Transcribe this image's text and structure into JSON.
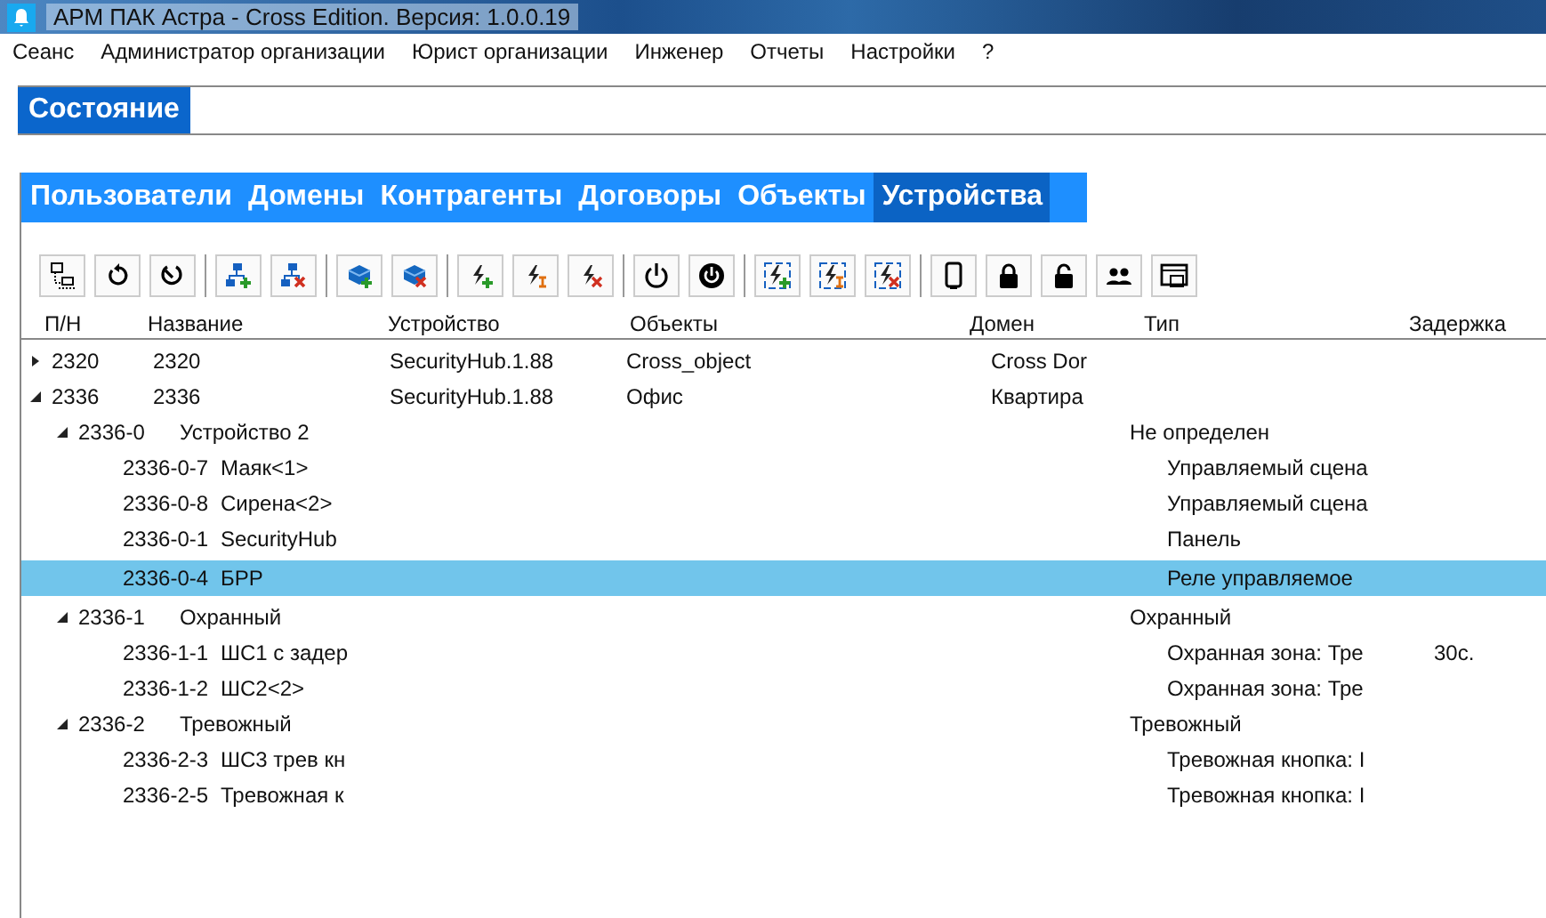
{
  "window": {
    "title": "АРМ ПАК Астра - Cross Edition. Версия: 1.0.0.19"
  },
  "menu": [
    "Сеанс",
    "Администратор организации",
    "Юрист организации",
    "Инженер",
    "Отчеты",
    "Настройки",
    "?"
  ],
  "state_tab": {
    "label": "Состояние"
  },
  "tabs": [
    {
      "label": "Пользователи",
      "selected": false
    },
    {
      "label": "Домены",
      "selected": false
    },
    {
      "label": "Контрагенты",
      "selected": false
    },
    {
      "label": "Договоры",
      "selected": false
    },
    {
      "label": "Объекты",
      "selected": false
    },
    {
      "label": "Устройства",
      "selected": true
    }
  ],
  "table": {
    "columns": [
      "П/Н",
      "Название",
      "Устройство",
      "Объекты",
      "Домен",
      "Тип",
      "Задержка"
    ],
    "rows": [
      {
        "pn": "2320",
        "name": "2320",
        "device": "SecurityHub.1.88",
        "object": "Cross_object",
        "domain": "Cross Dor",
        "expanded": false,
        "selected": false
      },
      {
        "pn": "2336",
        "name": "2336",
        "device": "SecurityHub.1.88",
        "object": "Офис",
        "domain": "Квартира",
        "expanded": true,
        "selected": false,
        "children": [
          {
            "pn": "2336-0",
            "name": "Устройство 2",
            "type": "Не определен",
            "expanded": true,
            "selected": false,
            "children": [
              {
                "pn": "2336-0-7",
                "name": "Маяк<1>",
                "type": "Управляемый сцена",
                "selected": false
              },
              {
                "pn": "2336-0-8",
                "name": "Сирена<2>",
                "type": "Управляемый сцена",
                "selected": false
              },
              {
                "pn": "2336-0-1",
                "name": "SecurityHub",
                "type": "Панель",
                "selected": false
              },
              {
                "pn": "2336-0-4",
                "name": "БРР",
                "type": "Реле управляемое",
                "selected": true
              }
            ]
          },
          {
            "pn": "2336-1",
            "name": "Охранный",
            "type": "Охранный",
            "expanded": true,
            "selected": false,
            "children": [
              {
                "pn": "2336-1-1",
                "name": "ШС1 с задер",
                "type": "Охранная зона: Тре",
                "delay": "30с.",
                "selected": false
              },
              {
                "pn": "2336-1-2",
                "name": "ШС2<2>",
                "type": "Охранная зона: Тре",
                "selected": false
              }
            ]
          },
          {
            "pn": "2336-2",
            "name": "Тревожный",
            "type": "Тревожный",
            "expanded": true,
            "selected": false,
            "children": [
              {
                "pn": "2336-2-3",
                "name": "ШС3 трев кн",
                "type": "Тревожная кнопка: I",
                "selected": false
              },
              {
                "pn": "2336-2-5",
                "name": "Тревожная к",
                "type": "Тревожная кнопка: I",
                "selected": false
              }
            ]
          }
        ]
      }
    ]
  }
}
